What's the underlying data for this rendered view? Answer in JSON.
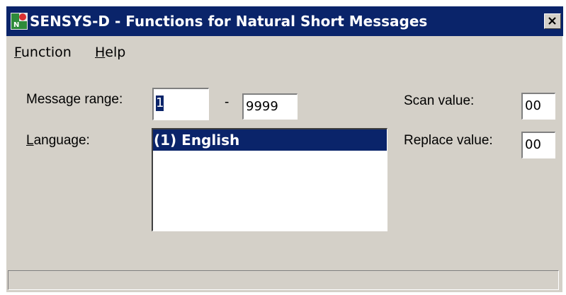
{
  "window": {
    "title": "SENSYS-D - Functions  for Natural Short Messages",
    "close_label": "X"
  },
  "menu": {
    "items": [
      {
        "label": "Function"
      },
      {
        "label": "Help"
      }
    ]
  },
  "form": {
    "message_range_label": "Message range:",
    "range_from": "1",
    "range_separator": "-",
    "range_to": "9999",
    "language_label": "Language:",
    "languages": [
      "(1) English"
    ],
    "selected_language": "(1) English",
    "scan_value_label": "Scan value:",
    "scan_value": "00",
    "replace_value_label": "Replace value:",
    "replace_value": "00"
  },
  "status": {
    "text": ""
  },
  "colors": {
    "titlebar": "#0a246a",
    "face": "#d4d0c8",
    "selection": "#0a246a"
  }
}
